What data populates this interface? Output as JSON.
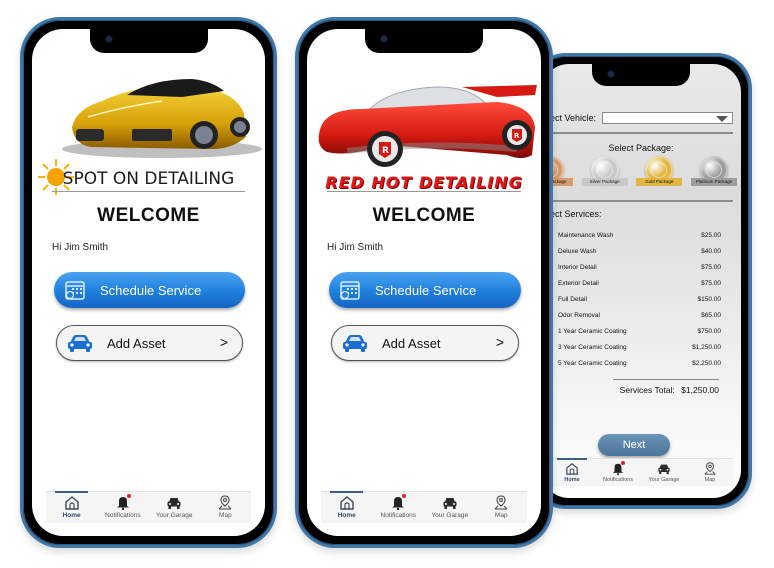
{
  "phones": [
    {
      "brand": "SPOT ON DETAILING",
      "welcome": "WELCOME",
      "greeting": "Hi Jim Smith",
      "buttons": {
        "schedule": "Schedule Service",
        "add_asset": "Add Asset",
        "add_asset_chevron": ">"
      }
    },
    {
      "brand": "RED HOT DETAILING",
      "welcome": "WELCOME",
      "greeting": "Hi Jim Smith",
      "buttons": {
        "schedule": "Schedule Service",
        "add_asset": "Add Asset",
        "add_asset_chevron": ">"
      }
    }
  ],
  "tabbar": {
    "active": "home",
    "items": [
      {
        "id": "home",
        "label": "Home",
        "icon": "home-icon"
      },
      {
        "id": "notifications",
        "label": "Notifications",
        "icon": "bell-icon",
        "badge": true
      },
      {
        "id": "garage",
        "label": "Your Garage",
        "icon": "car-icon"
      },
      {
        "id": "map",
        "label": "Map",
        "icon": "map-pin-icon"
      }
    ]
  },
  "services_screen": {
    "vehicle_label": "Select Vehicle:",
    "vehicle_value": "",
    "package_title": "Select Package:",
    "packages": [
      {
        "label": "Bronze Package",
        "color": "#d79a6c"
      },
      {
        "label": "Silver Package",
        "color": "#c9c9c9"
      },
      {
        "label": "Gold Package",
        "color": "#e2b640"
      },
      {
        "label": "Platinum Package",
        "color": "#9e9e9e"
      }
    ],
    "services_title": "Select Services:",
    "services": [
      {
        "name": "Maintenance Wash",
        "price": "$25.00",
        "checked": false
      },
      {
        "name": "Deluxe Wash",
        "price": "$40.00",
        "checked": false
      },
      {
        "name": "Interior Detail",
        "price": "$75.00",
        "checked": false
      },
      {
        "name": "Exterior Detail",
        "price": "$75.00",
        "checked": false
      },
      {
        "name": "Full Detail",
        "price": "$150.00",
        "checked": false
      },
      {
        "name": "Odor Removal",
        "price": "$65.00",
        "checked": false
      },
      {
        "name": "1 Year Ceramic Coating",
        "price": "$750.00",
        "checked": false
      },
      {
        "name": "3 Year Ceramic Coating",
        "price": "$1,250.00",
        "checked": true
      },
      {
        "name": "5 Year Ceramic Coating",
        "price": "$2,250.00",
        "checked": false
      }
    ],
    "total_label": "Services Total:",
    "total_value": "$1,250.00",
    "next_label": "Next"
  },
  "colors": {
    "frame": "#3f77a8",
    "primary_button": "#1f7fdc",
    "next_button": "#5a83a8",
    "notification_dot": "#e52222",
    "red_brand": "#e01818"
  }
}
